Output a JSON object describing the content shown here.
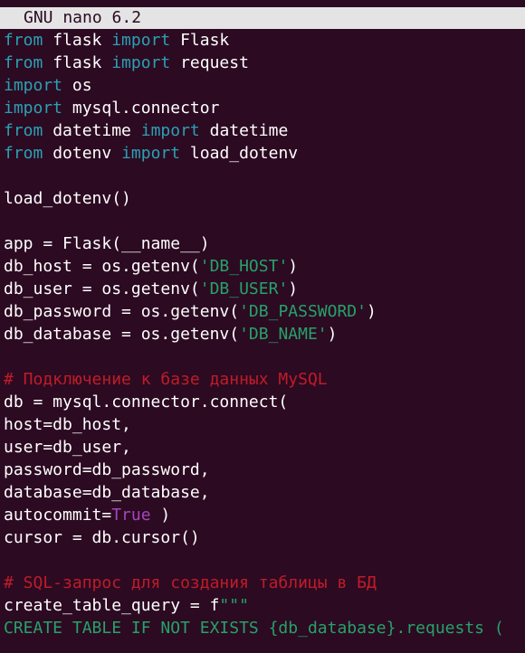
{
  "window": {
    "title": "GNU nano 6.2"
  },
  "colors": {
    "background": "#2c0a22",
    "titlebar": "#e4e4e4",
    "keyword": "#2aa1b3",
    "string": "#26a269",
    "comment": "#c01c28",
    "boolean": "#a347ba",
    "text": "#ffffff"
  },
  "editor": {
    "lines": [
      [
        {
          "t": "kw",
          "v": "from"
        },
        {
          "t": "txt",
          "v": " flask "
        },
        {
          "t": "kw",
          "v": "import"
        },
        {
          "t": "txt",
          "v": " Flask"
        }
      ],
      [
        {
          "t": "kw",
          "v": "from"
        },
        {
          "t": "txt",
          "v": " flask "
        },
        {
          "t": "kw",
          "v": "import"
        },
        {
          "t": "txt",
          "v": " request"
        }
      ],
      [
        {
          "t": "kw",
          "v": "import"
        },
        {
          "t": "txt",
          "v": " os"
        }
      ],
      [
        {
          "t": "kw",
          "v": "import"
        },
        {
          "t": "txt",
          "v": " mysql.connector"
        }
      ],
      [
        {
          "t": "kw",
          "v": "from"
        },
        {
          "t": "txt",
          "v": " datetime "
        },
        {
          "t": "kw",
          "v": "import"
        },
        {
          "t": "txt",
          "v": " datetime"
        }
      ],
      [
        {
          "t": "kw",
          "v": "from"
        },
        {
          "t": "txt",
          "v": " dotenv "
        },
        {
          "t": "kw",
          "v": "import"
        },
        {
          "t": "txt",
          "v": " load_dotenv"
        }
      ],
      [],
      [
        {
          "t": "txt",
          "v": "load_dotenv()"
        }
      ],
      [],
      [
        {
          "t": "txt",
          "v": "app = Flask(__name__)"
        }
      ],
      [
        {
          "t": "txt",
          "v": "db_host = os.getenv("
        },
        {
          "t": "str",
          "v": "'DB_HOST'"
        },
        {
          "t": "txt",
          "v": ")"
        }
      ],
      [
        {
          "t": "txt",
          "v": "db_user = os.getenv("
        },
        {
          "t": "str",
          "v": "'DB_USER'"
        },
        {
          "t": "txt",
          "v": ")"
        }
      ],
      [
        {
          "t": "txt",
          "v": "db_password = os.getenv("
        },
        {
          "t": "str",
          "v": "'DB_PASSWORD'"
        },
        {
          "t": "txt",
          "v": ")"
        }
      ],
      [
        {
          "t": "txt",
          "v": "db_database = os.getenv("
        },
        {
          "t": "str",
          "v": "'DB_NAME'"
        },
        {
          "t": "txt",
          "v": ")"
        }
      ],
      [],
      [
        {
          "t": "cmt",
          "v": "# Подключение к базе данных MySQL"
        }
      ],
      [
        {
          "t": "txt",
          "v": "db = mysql.connector.connect("
        }
      ],
      [
        {
          "t": "txt",
          "v": "host=db_host,"
        }
      ],
      [
        {
          "t": "txt",
          "v": "user=db_user,"
        }
      ],
      [
        {
          "t": "txt",
          "v": "password=db_password,"
        }
      ],
      [
        {
          "t": "txt",
          "v": "database=db_database,"
        }
      ],
      [
        {
          "t": "txt",
          "v": "autocommit="
        },
        {
          "t": "bool",
          "v": "True"
        },
        {
          "t": "txt",
          "v": " )"
        }
      ],
      [
        {
          "t": "txt",
          "v": "cursor = db.cursor()"
        }
      ],
      [],
      [
        {
          "t": "cmt",
          "v": "# SQL-запрос для создания таблицы в БД"
        }
      ],
      [
        {
          "t": "txt",
          "v": "create_table_query = f"
        },
        {
          "t": "str",
          "v": "\"\"\""
        }
      ],
      [
        {
          "t": "str",
          "v": "CREATE TABLE IF NOT EXISTS {db_database}.requests ("
        }
      ]
    ]
  }
}
